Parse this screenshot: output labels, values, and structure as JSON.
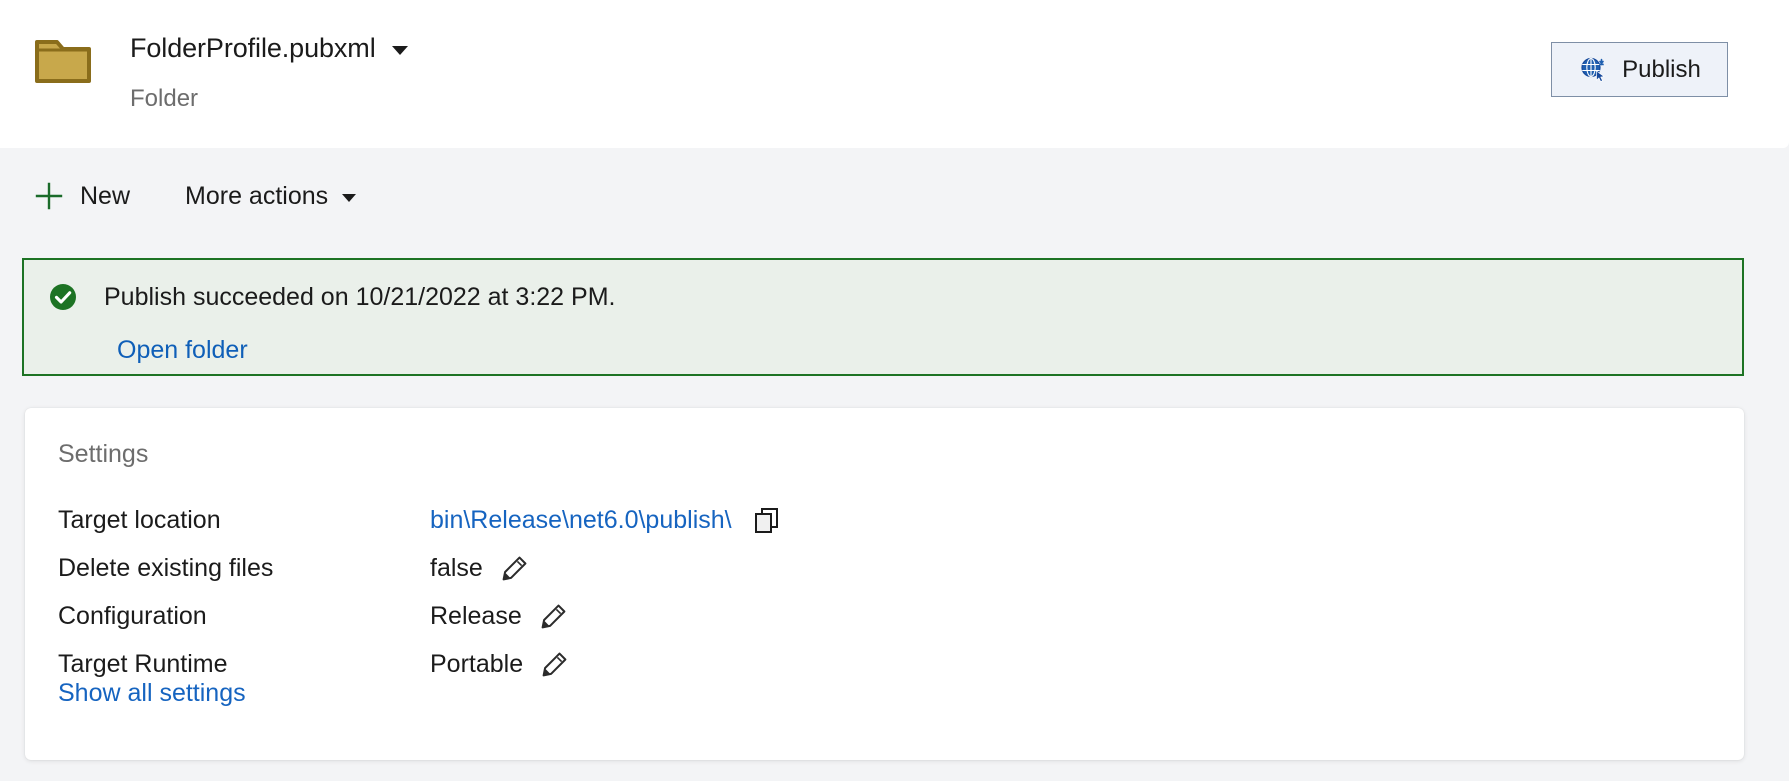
{
  "header": {
    "profile_name": "FolderProfile.pubxml",
    "profile_type": "Folder",
    "folder_icon": "folder-icon",
    "dropdown_icon": "chevron-down-icon",
    "publish_button_label": "Publish",
    "publish_button_icon": "publish-globe-icon"
  },
  "toolbar": {
    "new_label": "New",
    "new_icon": "plus-icon",
    "more_actions_label": "More actions",
    "more_actions_icon": "chevron-down-icon"
  },
  "banner": {
    "status_icon": "success-check-icon",
    "message": "Publish succeeded on 10/21/2022 at 3:22 PM.",
    "link_label": "Open folder",
    "border_color": "#1d7324",
    "background_color": "#eaf0ea",
    "icon_color": "#1d7324"
  },
  "settings": {
    "title": "Settings",
    "rows": [
      {
        "label": "Target location",
        "value": "bin\\Release\\net6.0\\publish\\",
        "is_link": true,
        "action_icon": "copy-icon"
      },
      {
        "label": "Delete existing files",
        "value": "false",
        "is_link": false,
        "action_icon": "pencil-edit-icon"
      },
      {
        "label": "Configuration",
        "value": "Release",
        "is_link": false,
        "action_icon": "pencil-edit-icon"
      },
      {
        "label": "Target Runtime",
        "value": "Portable",
        "is_link": false,
        "action_icon": "pencil-edit-icon"
      }
    ],
    "show_all_label": "Show all settings",
    "link_color": "#1664c0"
  }
}
